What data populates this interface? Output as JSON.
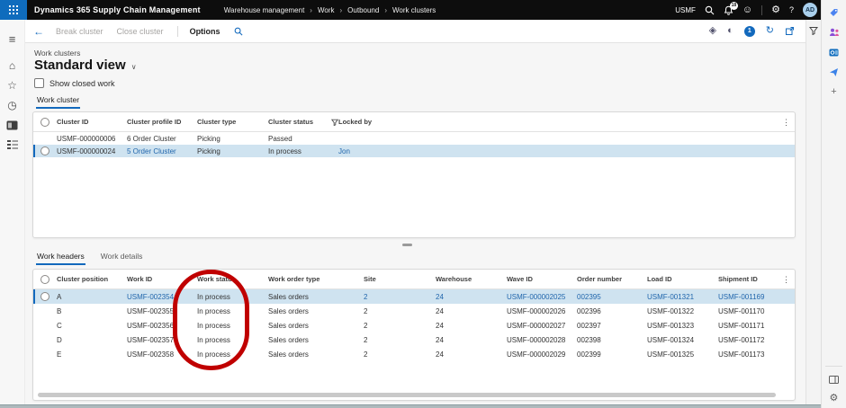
{
  "topbar": {
    "app_title": "Dynamics 365 Supply Chain Management",
    "breadcrumb": [
      "Warehouse management",
      "Work",
      "Outbound",
      "Work clusters"
    ],
    "company": "USMF",
    "notification_count": "18",
    "help_label": "?",
    "avatar_initials": "AD"
  },
  "command_bar": {
    "buttons": [
      {
        "label": "Break cluster",
        "disabled": true
      },
      {
        "label": "Close cluster",
        "disabled": true
      },
      {
        "label": "Options",
        "disabled": false
      }
    ],
    "attachment_badge": "1"
  },
  "page": {
    "caption": "Work clusters",
    "view_title": "Standard view",
    "show_closed_label": "Show closed work",
    "cluster_tab": "Work cluster",
    "detail_tabs": [
      {
        "label": "Work headers",
        "active": true
      },
      {
        "label": "Work details",
        "active": false
      }
    ]
  },
  "clusters_grid": {
    "columns": [
      "Cluster ID",
      "Cluster profile ID",
      "Cluster type",
      "Cluster status",
      "Locked by"
    ],
    "filtered_column": "Cluster status",
    "rows": [
      {
        "cells": [
          "USMF-000000006",
          "6 Order Cluster",
          "Picking",
          "Passed",
          ""
        ],
        "selected": false,
        "link_cells": []
      },
      {
        "cells": [
          "USMF-000000024",
          "5 Order Cluster",
          "Picking",
          "In process",
          "Jon"
        ],
        "selected": true,
        "link_cells": [
          1,
          4
        ]
      }
    ]
  },
  "work_grid": {
    "columns": [
      "Cluster position",
      "Work ID",
      "Work status",
      "Work order type",
      "Site",
      "Warehouse",
      "Wave ID",
      "Order number",
      "Load ID",
      "Shipment ID"
    ],
    "rows": [
      {
        "cells": [
          "A",
          "USMF-002354",
          "In process",
          "Sales orders",
          "2",
          "24",
          "USMF-000002025",
          "002395",
          "USMF-001321",
          "USMF-001169"
        ],
        "selected": true,
        "link_cells": [
          1,
          4,
          5,
          6,
          7,
          8,
          9
        ]
      },
      {
        "cells": [
          "B",
          "USMF-002355",
          "In process",
          "Sales orders",
          "2",
          "24",
          "USMF-000002026",
          "002396",
          "USMF-001322",
          "USMF-001170"
        ],
        "selected": false,
        "link_cells": []
      },
      {
        "cells": [
          "C",
          "USMF-002356",
          "In process",
          "Sales orders",
          "2",
          "24",
          "USMF-000002027",
          "002397",
          "USMF-001323",
          "USMF-001171"
        ],
        "selected": false,
        "link_cells": []
      },
      {
        "cells": [
          "D",
          "USMF-002357",
          "In process",
          "Sales orders",
          "2",
          "24",
          "USMF-000002028",
          "002398",
          "USMF-001324",
          "USMF-001172"
        ],
        "selected": false,
        "link_cells": []
      },
      {
        "cells": [
          "E",
          "USMF-002358",
          "In process",
          "Sales orders",
          "2",
          "24",
          "USMF-000002029",
          "002399",
          "USMF-001325",
          "USMF-001173"
        ],
        "selected": false,
        "link_cells": []
      }
    ]
  },
  "annotation": {
    "shape": "ellipse",
    "color": "#c00000",
    "target_column": "Work status"
  },
  "icons": {
    "back": "←",
    "menu": "≡",
    "home": "⌂",
    "favorites": "☆",
    "recent": "◷",
    "smiley": "☺",
    "gear": "⚙",
    "more": "⋮",
    "refresh": "↻",
    "personalize": "◈",
    "contrast": "◐",
    "add": "+",
    "chevron": "›",
    "dropdown": "∨"
  },
  "colors": {
    "accent": "#1269bd",
    "link": "#2166ac",
    "selected_row": "#cfe3f0",
    "topbar_bg": "#0d0d0d",
    "waffle": "#0f6cbd",
    "annotation": "#c00000"
  }
}
